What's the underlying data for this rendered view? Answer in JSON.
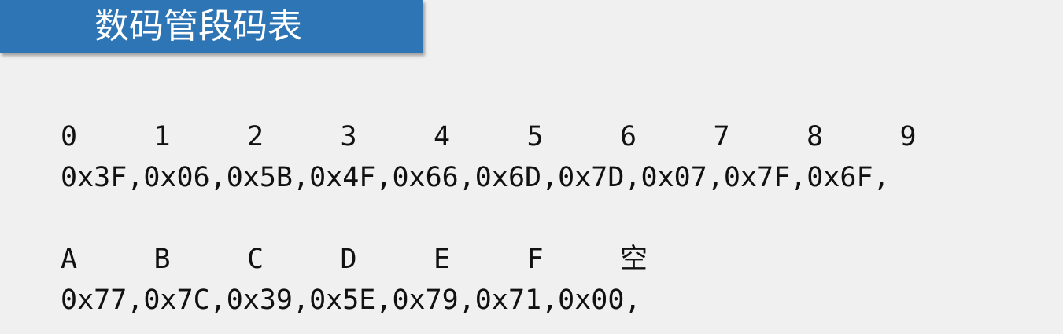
{
  "title": "数码管段码表",
  "groups": [
    {
      "labels": [
        "0",
        "1",
        "2",
        "3",
        "4",
        "5",
        "6",
        "7",
        "8",
        "9"
      ],
      "codes": [
        "0x3F,",
        "0x06,",
        "0x5B,",
        "0x4F,",
        "0x66,",
        "0x6D,",
        "0x7D,",
        "0x07,",
        "0x7F,",
        "0x6F,"
      ]
    },
    {
      "labels": [
        "A",
        "B",
        "C",
        "D",
        "E",
        "F",
        "空"
      ],
      "codes": [
        "0x77,",
        "0x7C,",
        "0x39,",
        "0x5E,",
        "0x79,",
        "0x71,",
        "0x00,"
      ]
    }
  ]
}
